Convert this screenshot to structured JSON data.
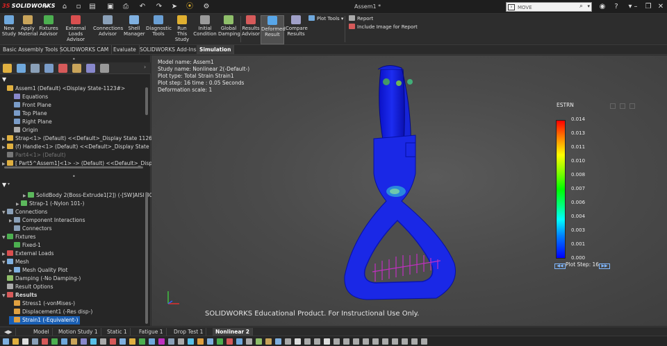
{
  "titlebar": {
    "logo_ds": "3S",
    "logo_text": "SOLIDWORKS",
    "doc_title": "Assem1 *",
    "search_value": "MOVE"
  },
  "ribbon": {
    "buttons": [
      {
        "label": "New\nStudy",
        "icon_color": "#6fa8dc"
      },
      {
        "label": "Apply\nMaterial",
        "icon_color": "#c9a45a"
      },
      {
        "label": "Fixtures\nAdvisor",
        "icon_color": "#4caf50"
      },
      {
        "label": "External Loads\nAdvisor",
        "icon_color": "#d94f4f"
      },
      {
        "label": "Connections\nAdvisor",
        "icon_color": "#8aa0b8"
      },
      {
        "label": "Shell\nManager",
        "icon_color": "#7fb0e0"
      },
      {
        "label": "Diagnostic\nTools",
        "icon_color": "#6a9fd4"
      },
      {
        "label": "Run This\nStudy",
        "icon_color": "#e0b030"
      },
      {
        "label": "Initial\nCondition",
        "icon_color": "#9a9a9a"
      },
      {
        "label": "Global\nDamping",
        "icon_color": "#8fbf6a"
      },
      {
        "label": "Results\nAdvisor",
        "icon_color": "#d65a5a"
      },
      {
        "label": "Deformed\nResult",
        "icon_color": "#58a6e8"
      },
      {
        "label": "Compare\nResults",
        "icon_color": "#a0a0c8"
      }
    ],
    "plot_tools": "Plot Tools",
    "report": "Report",
    "include_image": "Include Image for Report"
  },
  "command_tabs": [
    "Basic Assembly Tools",
    "SOLIDWORKS CAM",
    "Evaluate",
    "SOLIDWORKS Add-Ins",
    "Simulation"
  ],
  "tree_top": [
    {
      "label": "Assem1 (Default) <Display State-1123#>",
      "level": 0,
      "arrow": "",
      "icon": "#e0b040"
    },
    {
      "label": "Equations",
      "level": 1,
      "arrow": "",
      "icon": "#8888cc"
    },
    {
      "label": "Front Plane",
      "level": 1,
      "arrow": "",
      "icon": "#7a9cc8"
    },
    {
      "label": "Top Plane",
      "level": 1,
      "arrow": "",
      "icon": "#7a9cc8"
    },
    {
      "label": "Right Plane",
      "level": 1,
      "arrow": "",
      "icon": "#7a9cc8"
    },
    {
      "label": "Origin",
      "level": 1,
      "arrow": "",
      "icon": "#aaaaaa"
    },
    {
      "label": "Strap<1> (Default) <<Default>_Display State 1126",
      "level": 0,
      "arrow": "▶",
      "icon": "#e0b040"
    },
    {
      "label": "(f) Handle<1> (Default) <<Default>_Display State",
      "level": 0,
      "arrow": "▶",
      "icon": "#e0b040"
    },
    {
      "label": "Part4<1> (Default)",
      "level": 0,
      "arrow": "",
      "icon": "#777777",
      "dim": true
    },
    {
      "label": "[ Part5^Assem1]<1> -> (Default) <<Default>_Disp",
      "level": 0,
      "arrow": "▶",
      "icon": "#e0b040"
    }
  ],
  "tree_bottom": [
    {
      "label": "SolidBody 2(Boss-Extrude1[2]) (-[SW]AISI 30",
      "level": 3,
      "arrow": "▶",
      "icon": "#5cb85c"
    },
    {
      "label": "Strap-1 (-Nylon 101-)",
      "level": 2,
      "arrow": "▶",
      "icon": "#5cb85c"
    },
    {
      "label": "Connections",
      "level": 0,
      "arrow": "▼",
      "icon": "#8aa0b8"
    },
    {
      "label": "Component Interactions",
      "level": 1,
      "arrow": "▶",
      "icon": "#8aa0b8"
    },
    {
      "label": "Connectors",
      "level": 1,
      "arrow": "",
      "icon": "#8aa0b8"
    },
    {
      "label": "Fixtures",
      "level": 0,
      "arrow": "▼",
      "icon": "#4caf50"
    },
    {
      "label": "Fixed-1",
      "level": 1,
      "arrow": "",
      "icon": "#4caf50"
    },
    {
      "label": "External Loads",
      "level": 0,
      "arrow": "▶",
      "icon": "#d94f4f"
    },
    {
      "label": "Mesh",
      "level": 0,
      "arrow": "▼",
      "icon": "#7fb0e0"
    },
    {
      "label": "Mesh Quality Plot",
      "level": 1,
      "arrow": "▶",
      "icon": "#7fb0e0"
    },
    {
      "label": "Damping (-No Damping-)",
      "level": 0,
      "arrow": "",
      "icon": "#8fbf6a"
    },
    {
      "label": "Result Options",
      "level": 0,
      "arrow": "",
      "icon": "#aaaaaa"
    },
    {
      "label": "Results",
      "level": 0,
      "arrow": "▼",
      "icon": "#d65a5a",
      "bold": true
    },
    {
      "label": "Stress1 (-vonMises-)",
      "level": 1,
      "arrow": "",
      "icon": "#e0a040"
    },
    {
      "label": "Displacement1 (-Res disp-)",
      "level": 1,
      "arrow": "",
      "icon": "#e0a040"
    },
    {
      "label": "Strain1 (-Equivalent-)",
      "level": 1,
      "arrow": "",
      "icon": "#e0a040",
      "selected": true
    }
  ],
  "viewport": {
    "info": [
      "Model name: Assem1",
      "Study name: Nonlinear 2(-Default-)",
      "Plot type: Total Strain Strain1",
      "Plot step: 16   time : 0.05 Seconds",
      "Deformation scale: 1"
    ],
    "legend_title": "ESTRN",
    "legend_labels": [
      "0.014",
      "0.013",
      "0.011",
      "0.010",
      "0.008",
      "0.007",
      "0.006",
      "0.004",
      "0.003",
      "0.001",
      "0.000"
    ],
    "plot_step": "Plot Step: 16",
    "watermark": "SOLIDWORKS Educational Product. For Instructional Use Only."
  },
  "bottom_tabs": [
    "Model",
    "Motion Study 1",
    "Static 1",
    "Fatigue 1",
    "Drop Test 1",
    "Nonlinear 2"
  ]
}
